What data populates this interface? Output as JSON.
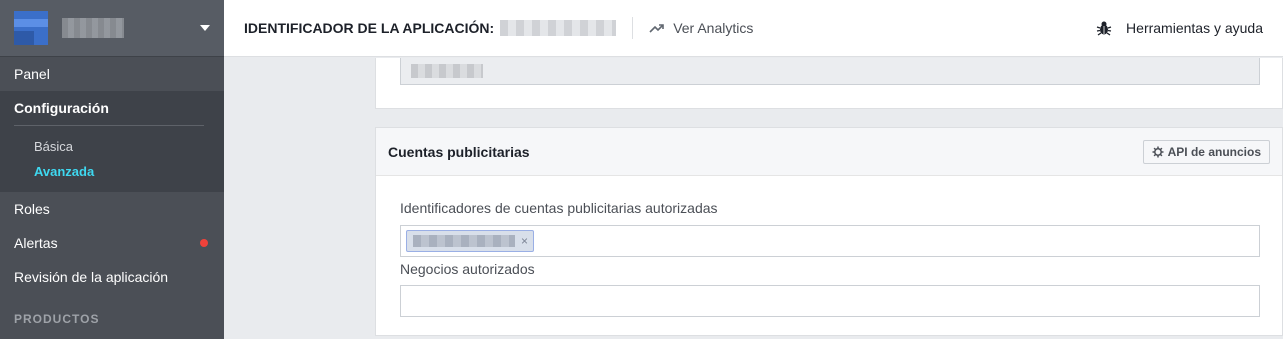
{
  "sidebar": {
    "nav": {
      "panel": "Panel",
      "configuracion": "Configuración",
      "basica": "Básica",
      "avanzada": "Avanzada",
      "roles": "Roles",
      "alertas": "Alertas",
      "revision": "Revisión de la aplicación"
    },
    "section_productos": "PRODUCTOS"
  },
  "topbar": {
    "app_id_label": "IDENTIFICADOR DE LA APLICACIÓN:",
    "analytics_label": "Ver Analytics",
    "tools_label": "Herramientas y ayuda"
  },
  "ad_accounts_panel": {
    "title": "Cuentas publicitarias",
    "api_button_label": "API de anuncios",
    "authorized_ids_label": "Identificadores de cuentas publicitarias autorizadas",
    "token_close": "×",
    "authorized_businesses_label": "Negocios autorizados"
  },
  "colors": {
    "sidebar_bg": "#4b4f56",
    "active_sub_item": "#3ed8f0",
    "alert_dot": "#f0423a",
    "token_bg": "#d8dfea"
  },
  "icons": [
    "app-logo-icon",
    "caret-down-icon",
    "trending-icon",
    "bug-icon",
    "gear-icon",
    "close-icon"
  ]
}
